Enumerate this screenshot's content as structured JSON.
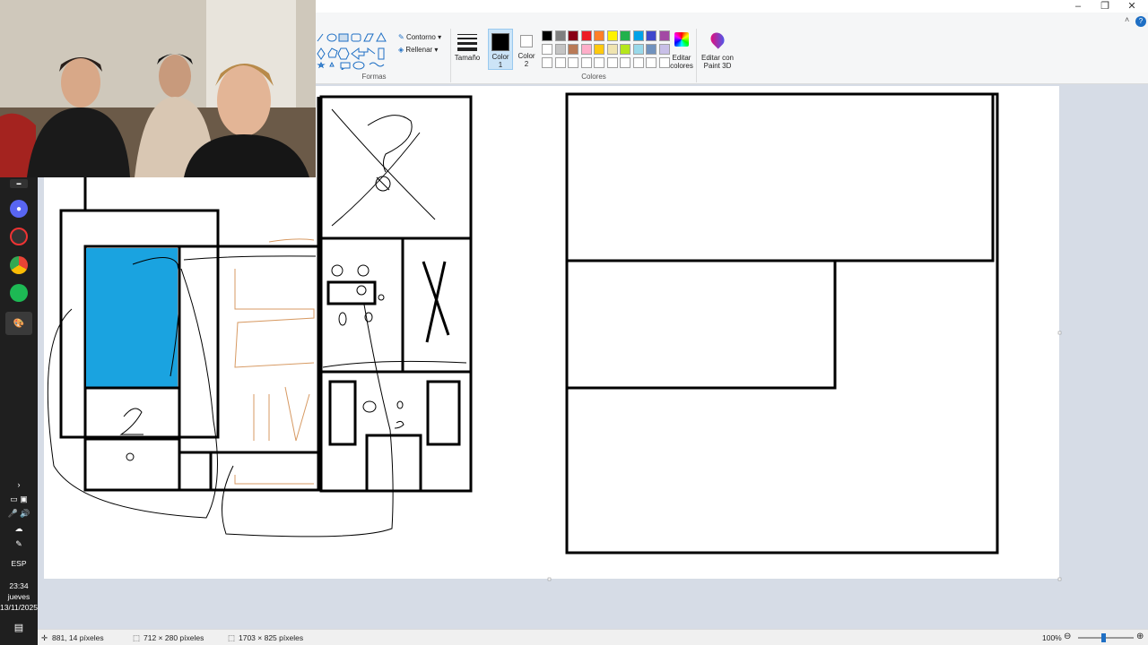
{
  "ribbon": {
    "outline_label": "Contorno",
    "fill_label": "Rellenar",
    "shapes_group": "Formas",
    "size_label": "Tamaño",
    "color1_label": "Color\n1",
    "color2_label": "Color\n2",
    "colors_group": "Colores",
    "edit_colors_label": "Editar\ncolores",
    "paint3d_label": "Editar con\nPaint 3D",
    "palette_row1": [
      "#000000",
      "#7f7f7f",
      "#880015",
      "#ed1c24",
      "#ff7f27",
      "#fff200",
      "#22b14c",
      "#00a2e8",
      "#3f48cc",
      "#a349a4"
    ],
    "palette_row2": [
      "#ffffff",
      "#c3c3c3",
      "#b97a57",
      "#ffaec9",
      "#ffc90e",
      "#efe4b0",
      "#b5e61d",
      "#99d9ea",
      "#7092be",
      "#c8bfe7"
    ],
    "color1": "#000000",
    "color2": "#ffffff"
  },
  "taskbar": {
    "lang": "ESP",
    "time": "23:34",
    "day": "jueves",
    "date": "13/11/2025"
  },
  "status": {
    "cursor_pos": "881, 14 píxeles",
    "selection_size": "712 × 280 píxeles",
    "image_size": "1703 × 825 píxeles",
    "zoom": "100%"
  },
  "colors": {
    "fill_blue": "#1aa3e0",
    "sketch_orange": "#d79a63"
  }
}
